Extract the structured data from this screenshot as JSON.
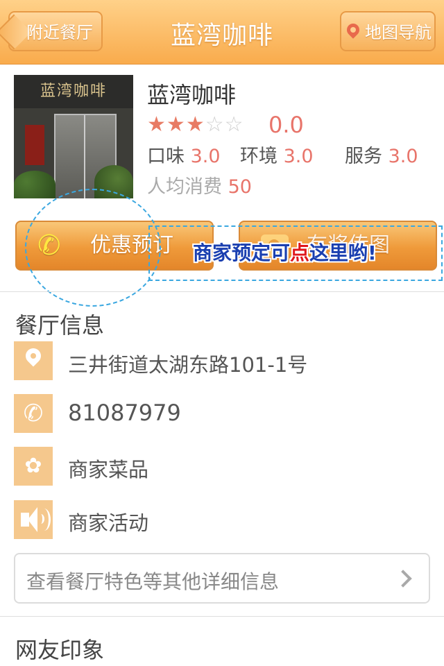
{
  "header": {
    "back_label": "附近餐厅",
    "title": "蓝湾咖啡",
    "nav_label": "地图导航",
    "nav_icon": "map-pin-icon"
  },
  "restaurant": {
    "photo_sign": "蓝湾咖啡",
    "name": "蓝湾咖啡",
    "stars": {
      "filled": 3,
      "total": 5
    },
    "rating": "0.0",
    "scores": [
      {
        "label": "口味",
        "value": "3.0"
      },
      {
        "label": "环境",
        "value": "3.0"
      },
      {
        "label": "服务",
        "value": "3.0"
      }
    ],
    "avg_label": "人均消费",
    "avg_value": "50"
  },
  "actions": {
    "book_label": "优惠预订",
    "book_icon": "phone-icon",
    "upload_label": "有奖传图",
    "upload_icon": "camera-icon"
  },
  "hint": {
    "before": "商家预定可",
    "highlight": "点",
    "after": "这里哟!"
  },
  "info": {
    "title": "餐厅信息",
    "items": [
      {
        "icon": "location-pin-icon",
        "text": "三井街道太湖东路101-1号"
      },
      {
        "icon": "phone-icon",
        "text": "81087979"
      },
      {
        "icon": "flower-icon",
        "text": "商家菜品"
      },
      {
        "icon": "speaker-icon",
        "text": "商家活动"
      }
    ],
    "details_label": "查看餐厅特色等其他详细信息"
  },
  "reviews": {
    "title": "网友印象"
  },
  "colors": {
    "header_top": "#ffd189",
    "header_bottom": "#f9ab4c",
    "accent": "#e8746a",
    "icon_bg": "#f5c88d",
    "button_orange": "#ef9a3a",
    "hint_blue": "#1a3fb0",
    "hint_red": "#e0171c"
  }
}
